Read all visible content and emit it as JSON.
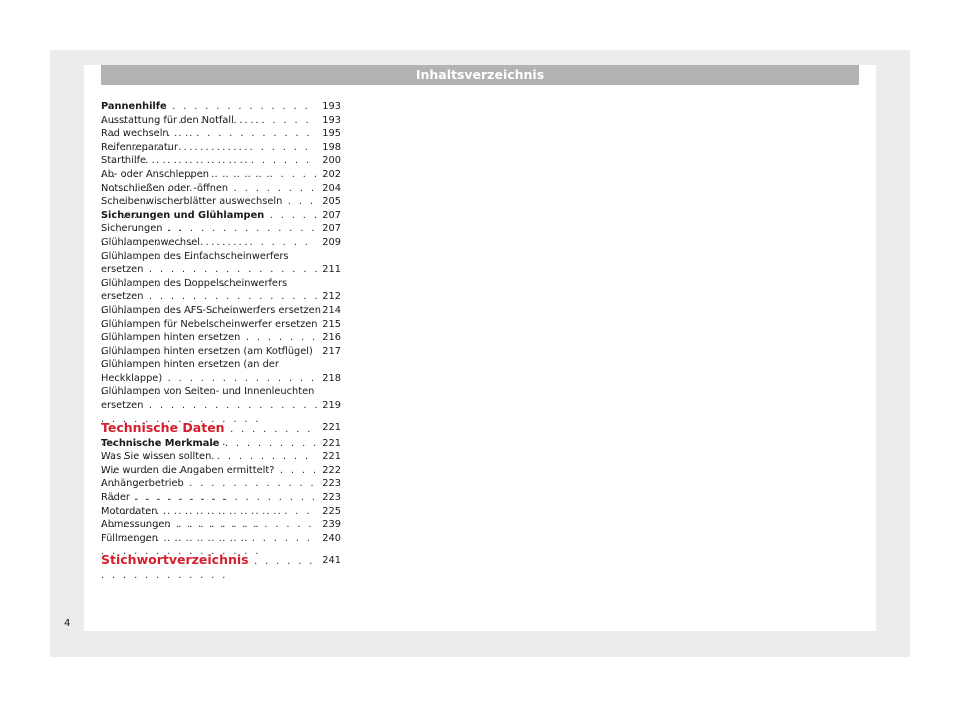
{
  "header": {
    "title": "Inhaltsverzeichnis"
  },
  "toc": [
    {
      "title": "Pannenhilfe",
      "dots": " . . . . . . . . . . . . . . . . . . . . . . . . . . . .",
      "page": "193",
      "style": "bold"
    },
    {
      "title": "Ausstattung für den Notfall",
      "dots": " . . . . . . . . . . . . . . . .",
      "page": "193",
      "style": "normal"
    },
    {
      "title": "Rad wechseln",
      "dots": " . . . . . . . . . . . . . . . . . . . . . . . . . . .",
      "page": "195",
      "style": "normal"
    },
    {
      "title": "Reifenreparatur",
      "dots": " . . . . . . . . . . . . . . . . . . . . . . . . . .",
      "page": "198",
      "style": "normal"
    },
    {
      "title": "Starthilfe",
      "dots": " . . . . . . . . . . . . . . . . . . . . . . . . . . . . . . .",
      "page": "200",
      "style": "normal"
    },
    {
      "title": "Ab- oder Anschleppen",
      "dots": " . . . . . . . . . . . . . . . . . . . .",
      "page": "202",
      "style": "normal"
    },
    {
      "title": "Notschließen oder -öffnen",
      "dots": " . . . . . . . . . . . . . . . . .",
      "page": "204",
      "style": "normal"
    },
    {
      "title": "Scheibenwischerblätter auswechseln",
      "dots": " . . . . . . .",
      "page": "205",
      "style": "normal"
    },
    {
      "title": "Sicherungen und Glühlampen",
      "dots": " . . . . . . . . . . . . .",
      "page": "207",
      "style": "bold"
    },
    {
      "title": "Sicherungen",
      "dots": " . . . . . . . . . . . . . . . . . . . . . . . . . . . .",
      "page": "207",
      "style": "normal"
    },
    {
      "title": "Glühlampenwechsel",
      "dots": " . . . . . . . . . . . . . . . . . . . . .",
      "page": "209",
      "style": "normal"
    },
    {
      "title": "Glühlampen des Einfachscheinwerfers\nersetzen",
      "dots": " . . . . . . . . . . . . . . . . . . . . . . . . . . . . . . .",
      "page": "211",
      "style": "two"
    },
    {
      "title": "Glühlampen des Doppelscheinwerfers\nersetzen",
      "dots": " . . . . . . . . . . . . . . . . . . . . . . . . . . . . . . .",
      "page": "212",
      "style": "two"
    },
    {
      "title": "Glühlampen des AFS-Scheinwerfers ersetzen",
      "dots": " .",
      "page": "214",
      "style": "normal"
    },
    {
      "title": "Glühlampen für Nebelscheinwerfer ersetzen",
      "dots": " . .",
      "page": "215",
      "style": "normal"
    },
    {
      "title": "Glühlampen hinten ersetzen",
      "dots": " . . . . . . . . . . . . . .",
      "page": "216",
      "style": "normal"
    },
    {
      "title": "Glühlampen hinten ersetzen (am Kotflügel)",
      "dots": " . .",
      "page": "217",
      "style": "normal"
    },
    {
      "title": "Glühlampen hinten ersetzen (an der\nHeckklappe)",
      "dots": " . . . . . . . . . . . . . . . . . . . . . . . . . . . .",
      "page": "218",
      "style": "two"
    },
    {
      "title": "Glühlampen von Seiten- und Innenleuchten\nersetzen",
      "dots": " . . . . . . . . . . . . . . . . . . . . . . . . . . . . . . .",
      "page": "219",
      "style": "two"
    },
    {
      "title": "Technische Daten",
      "dots": " . . . . . . . . . . . . . . . . . . . .",
      "page": "221",
      "style": "big"
    },
    {
      "title": "Technische Merkmale",
      "dots": " . . . . . . . . . . . . . . . . . . . .",
      "page": "221",
      "style": "bold"
    },
    {
      "title": "Was Sie wissen sollten",
      "dots": " . . . . . . . . . . . . . . . . . . .",
      "page": "221",
      "style": "normal"
    },
    {
      "title": "Wie wurden die Angaben ermittelt?",
      "dots": " . . . . . . . . .",
      "page": "222",
      "style": "normal"
    },
    {
      "title": "Anhängerbetrieb",
      "dots": " . . . . . . . . . . . . . . . . . . . . . . . .",
      "page": "223",
      "style": "normal"
    },
    {
      "title": "Räder",
      "dots": " . . . . . . . . . . . . . . . . . . . . . . . . . . . . . . . . . .",
      "page": "223",
      "style": "normal"
    },
    {
      "title": "Motordaten",
      "dots": " . . . . . . . . . . . . . . . . . . . . . . . . . . . . .",
      "page": "225",
      "style": "normal"
    },
    {
      "title": "Abmessungen",
      "dots": " . . . . . . . . . . . . . . . . . . . . . . . . . . .",
      "page": "239",
      "style": "normal"
    },
    {
      "title": "Füllmengen",
      "dots": " . . . . . . . . . . . . . . . . . . . . . . . . . . . . .",
      "page": "240",
      "style": "normal"
    },
    {
      "title": "Stichwortverzeichnis",
      "dots": " . . . . . . . . . . . . . . . . . .",
      "page": "241",
      "style": "big"
    }
  ],
  "page_number": "4",
  "colors": {
    "header_bg": "#b3b3b3",
    "accent_red": "#d4202c",
    "frame_bg": "#ececec"
  }
}
